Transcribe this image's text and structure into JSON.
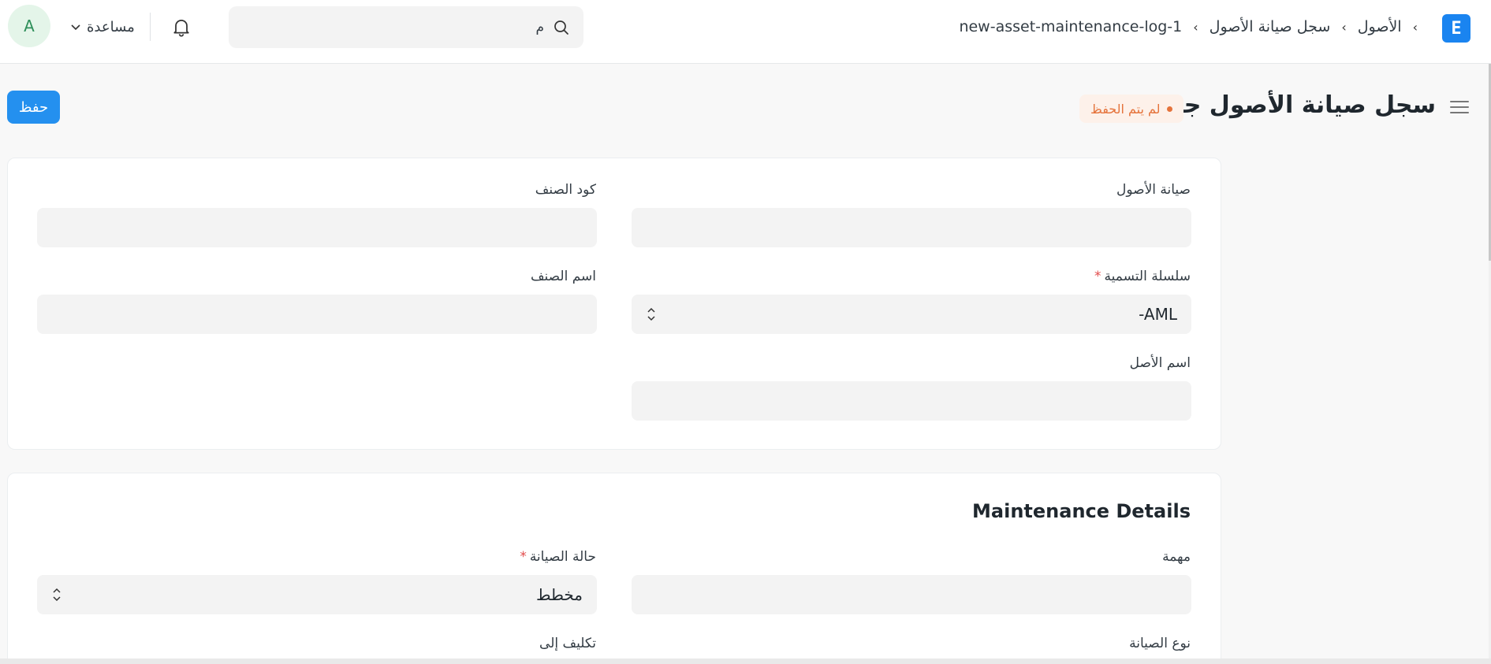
{
  "navbar": {
    "avatar_initial": "A",
    "help_label": "مساعدة",
    "search_placeholder": "م",
    "breadcrumb": [
      "الأصول",
      "سجل صيانة الأصول",
      "new-asset-maintenance-log-1"
    ],
    "logo_letter": "E",
    "icons": [
      "bell-icon",
      "search-icon",
      "chevron-down-icon",
      "app-logo-icon"
    ]
  },
  "header": {
    "title": "سجل صيانة الأصول جديد",
    "status": "لم يتم الحفظ",
    "save_label": "حفظ"
  },
  "colors": {
    "primary": "#2490ef",
    "status_orange": "#e5733b",
    "status_bg": "#fdf1ea",
    "avatar_bg": "#e4f5e9",
    "avatar_fg": "#2e8f5a"
  },
  "card1": {
    "asset_maintenance_label": "صيانة الأصول",
    "asset_maintenance_value": "",
    "item_code_label": "كود الصنف",
    "item_code_value": "",
    "naming_series_label": "سلسلة التسمية",
    "naming_series_value": "-AML",
    "item_name_label": "اسم الصنف",
    "item_name_value": "",
    "asset_name_label": "اسم الأصل",
    "asset_name_value": ""
  },
  "card2": {
    "section_title": "Maintenance Details",
    "task_label": "مهمة",
    "task_value": "",
    "maintenance_status_label": "حالة الصيانة",
    "maintenance_status_value": "مخطط",
    "maintenance_type_label": "نوع الصيانة",
    "assign_to_label": "تكليف إلى"
  },
  "required_mark": "*"
}
